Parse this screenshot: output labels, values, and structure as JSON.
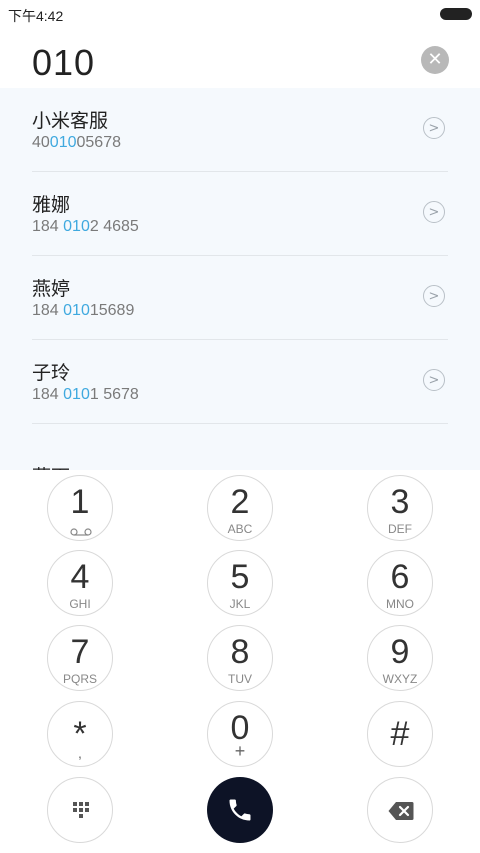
{
  "status_bar": {
    "time": "下午4:42"
  },
  "dialer": {
    "input_value": "010"
  },
  "contacts": [
    {
      "name": "小米客服",
      "number_pre": "40",
      "number_match": "010",
      "number_post": "05678"
    },
    {
      "name": "雅娜",
      "number_pre": "184 ",
      "number_match": "010",
      "number_post": "2 4685"
    },
    {
      "name": "燕婷",
      "number_pre": "184 ",
      "number_match": "010",
      "number_post": "15689"
    },
    {
      "name": "子玲",
      "number_pre": "184 ",
      "number_match": "010",
      "number_post": "1 5678"
    }
  ],
  "partial_label": "燕下",
  "keys": [
    {
      "digit": "1",
      "letters": ""
    },
    {
      "digit": "2",
      "letters": "ABC"
    },
    {
      "digit": "3",
      "letters": "DEF"
    },
    {
      "digit": "4",
      "letters": "GHI"
    },
    {
      "digit": "5",
      "letters": "JKL"
    },
    {
      "digit": "6",
      "letters": "MNO"
    },
    {
      "digit": "7",
      "letters": "PQRS"
    },
    {
      "digit": "8",
      "letters": "TUV"
    },
    {
      "digit": "9",
      "letters": "WXYZ"
    },
    {
      "digit": "*",
      "letters": ","
    },
    {
      "digit": "0",
      "letters": "+"
    },
    {
      "digit": "#",
      "letters": ""
    }
  ],
  "colors": {
    "match_highlight": "#3fa9df",
    "call_button": "#0d1326"
  },
  "icons": {
    "clear": "close-circle-icon",
    "chevron": "chevron-right-icon",
    "voicemail": "voicemail-icon",
    "dialpad": "dialpad-icon",
    "call": "phone-icon",
    "delete": "backspace-icon"
  }
}
